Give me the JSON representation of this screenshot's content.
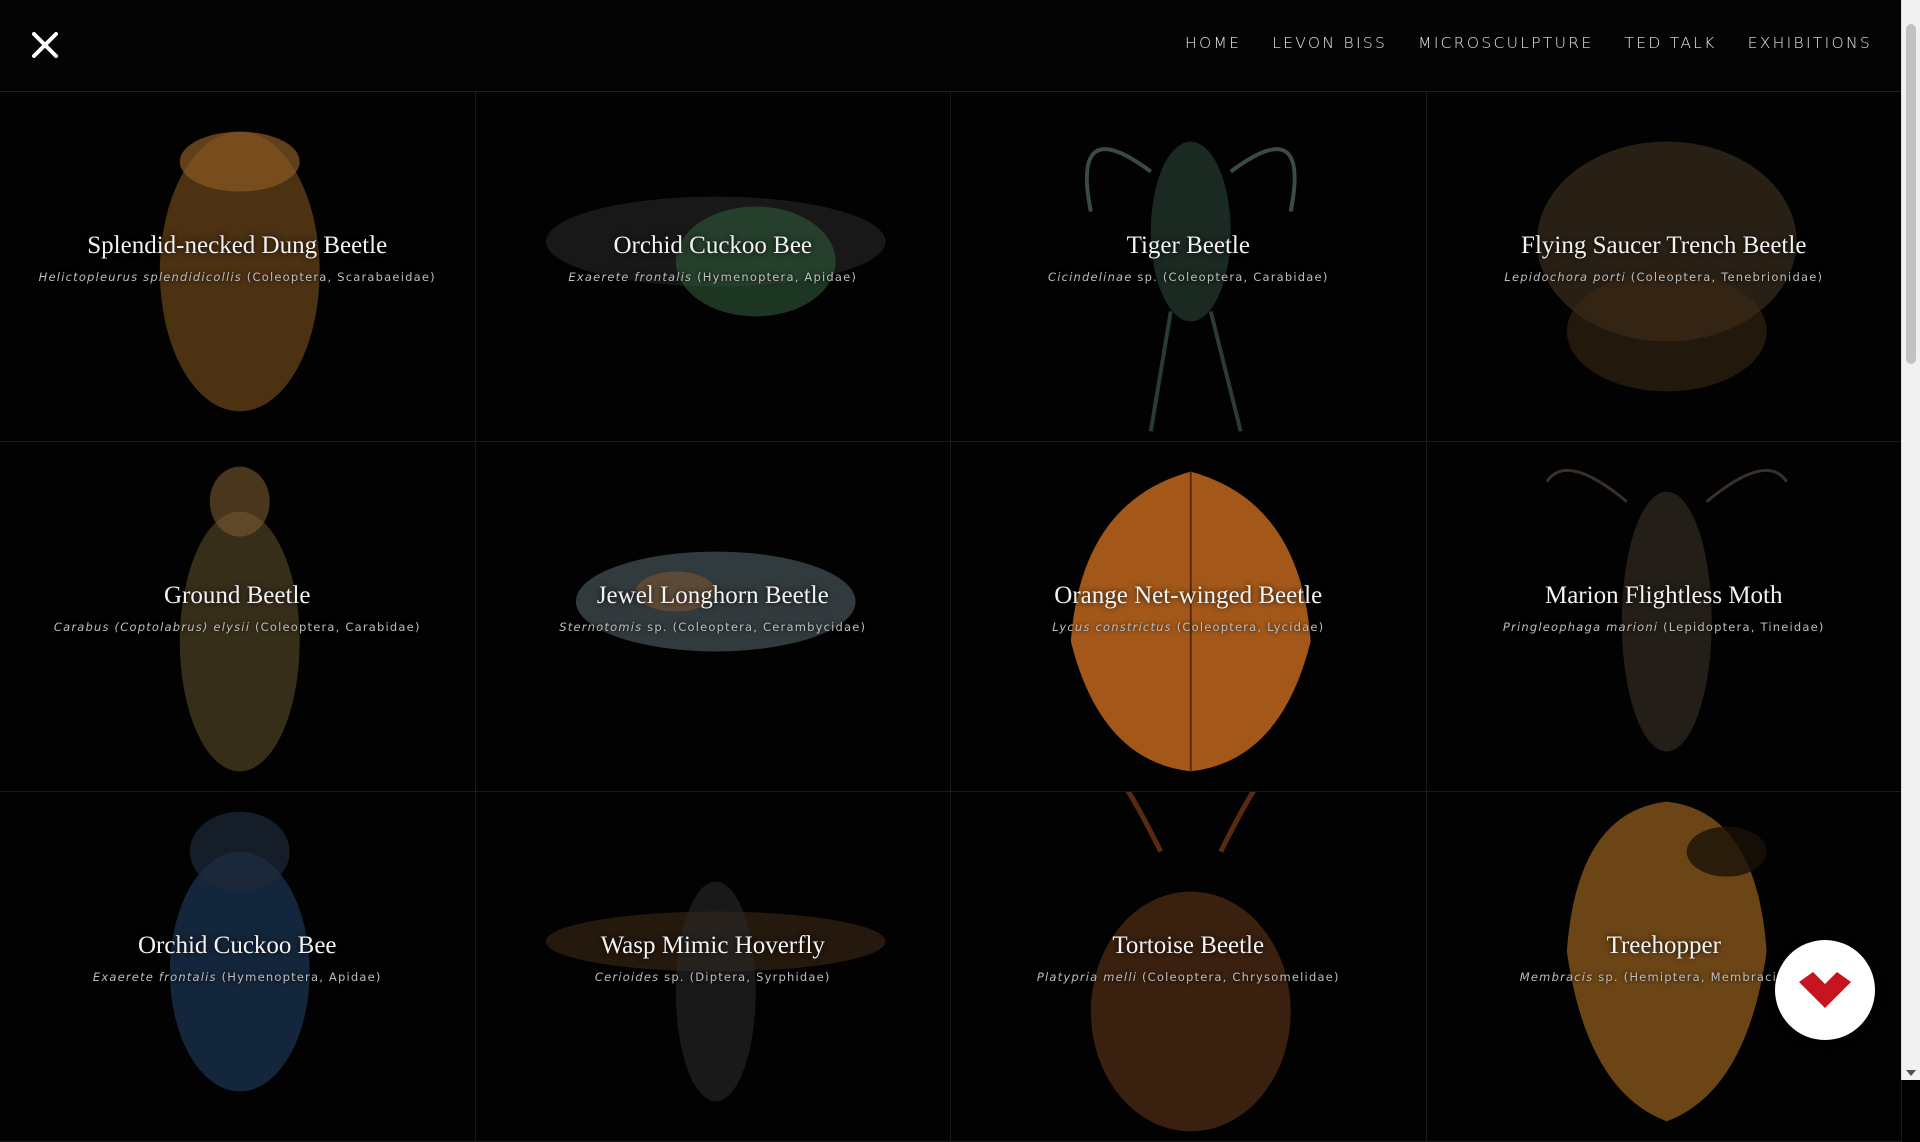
{
  "nav": {
    "items": [
      "HOME",
      "LEVON BISS",
      "MICROSCULPTURE",
      "TED TALK",
      "EXHIBITIONS"
    ]
  },
  "icons": {
    "close": "close-icon",
    "fab": "brand-logo-icon",
    "fab_color": "#c8141e"
  },
  "specimens": [
    {
      "name": "Splendid-necked Dung Beetle",
      "sci_italic": "Helictopleurus splendidicollis",
      "sci_rest": " (Coleoptera, Scarabaeidae)",
      "color": "#8a5a22"
    },
    {
      "name": "Orchid Cuckoo Bee",
      "sci_italic": "Exaerete frontalis",
      "sci_rest": " (Hymenoptera, Apidae)",
      "color": "#2e5a3a"
    },
    {
      "name": "Tiger Beetle",
      "sci_italic": "Cicindelinae",
      "sci_rest": " sp. (Coleoptera, Carabidae)",
      "color": "#2f4a3c"
    },
    {
      "name": "Flying Saucer Trench Beetle",
      "sci_italic": "Lepidochora porti",
      "sci_rest": " (Coleoptera, Tenebrionidae)",
      "color": "#4a3a26"
    },
    {
      "name": "Ground Beetle",
      "sci_italic": "Carabus (Coptolabrus) elysii",
      "sci_rest": " (Coleoptera, Carabidae)",
      "color": "#6a5a30"
    },
    {
      "name": "Jewel Longhorn Beetle",
      "sci_italic": "Sternotomis",
      "sci_rest": " sp. (Coleoptera, Cerambycidae)",
      "color": "#5a6a70"
    },
    {
      "name": "Orange Net-winged Beetle",
      "sci_italic": "Lycus constrictus",
      "sci_rest": " (Coleoptera, Lycidae)",
      "color": "#b5621c"
    },
    {
      "name": "Marion Flightless Moth",
      "sci_italic": "Pringleophaga marioni",
      "sci_rest": " (Lepidoptera, Tineidae)",
      "color": "#3c3228"
    },
    {
      "name": "Orchid Cuckoo Bee",
      "sci_italic": "Exaerete frontalis",
      "sci_rest": " (Hymenoptera, Apidae)",
      "color": "#1e3a5a"
    },
    {
      "name": "Wasp Mimic Hoverfly",
      "sci_italic": "Cerioides",
      "sci_rest": " sp. (Diptera, Syrphidae)",
      "color": "#5a3a1e"
    },
    {
      "name": "Tortoise Beetle",
      "sci_italic": "Platypria melli",
      "sci_rest": " (Coleoptera, Chrysomelidae)",
      "color": "#6a3a1a"
    },
    {
      "name": "Treehopper",
      "sci_italic": "Membracis",
      "sci_rest": " sp. (Hemiptera, Membracidae)",
      "color": "#9a6220"
    }
  ]
}
